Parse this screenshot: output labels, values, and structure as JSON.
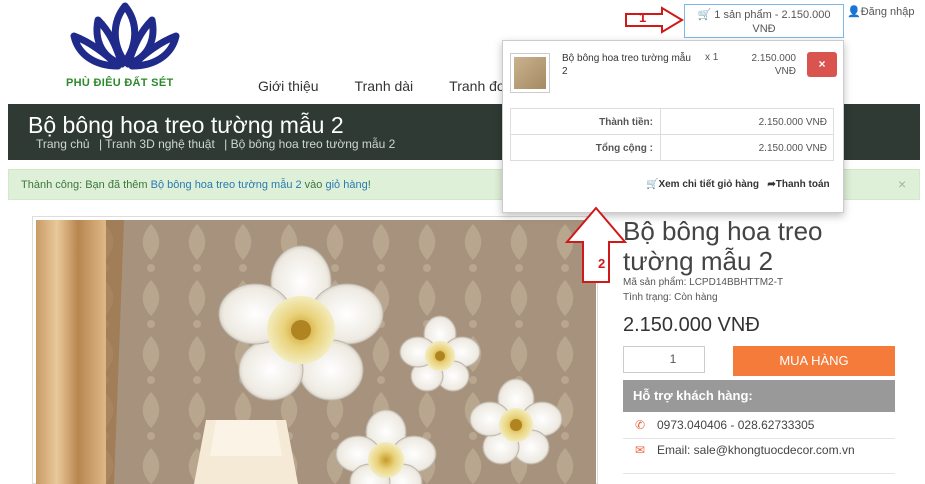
{
  "header": {
    "logo_text": "PHÙ ĐIÊU ĐẤT SÉT",
    "nav": [
      "Giới thiệu",
      "Tranh dài",
      "Tranh đơn"
    ],
    "cart_button": "1 sản phẩm - 2.150.000 VNĐ",
    "login": "Đăng nhập"
  },
  "page": {
    "title": "Bộ bông hoa treo tường mẫu 2",
    "breadcrumb": [
      "Trang chủ",
      "| Tranh 3D nghệ thuật",
      "| Bộ bông hoa treo tường mẫu 2"
    ]
  },
  "alert": {
    "prefix": "Thành công: Bạn đã thêm ",
    "product_link": "Bộ bông hoa treo tường mẫu 2",
    "middle": " vào ",
    "cart_link": "giỏ hàng",
    "suffix": "!",
    "close": "×"
  },
  "cart_dropdown": {
    "item_name": "Bộ bông hoa treo tường mẫu 2",
    "item_qty": "x 1",
    "item_price": "2.150.000 VNĐ",
    "remove": "×",
    "totals": [
      {
        "label": "Thành tiền:",
        "value": "2.150.000 VNĐ"
      },
      {
        "label": "Tổng cộng :",
        "value": "2.150.000 VNĐ"
      }
    ],
    "view_cart": "Xem chi tiết giỏ hàng",
    "checkout": "Thanh toán"
  },
  "product": {
    "title": "Bộ bông hoa treo tường mẫu 2",
    "code": "Mã sản phẩm: LCPD14BBHTTM2-T",
    "status": "Tình trạng: Còn hàng",
    "price": "2.150.000 VNĐ",
    "quantity": "1",
    "buy": "MUA HÀNG",
    "support_title": "Hỗ trợ khách hàng:",
    "phone": "0973.040406 - 028.62733305",
    "email": "Email: sale@khongtuocdecor.com.vn"
  },
  "annotations": {
    "one": "1",
    "two": "2"
  },
  "colors": {
    "accent_buy": "#f47b3a",
    "title_bar": "#2e3a33",
    "remove_button": "#d9534f",
    "callout": "#d01a1a"
  }
}
